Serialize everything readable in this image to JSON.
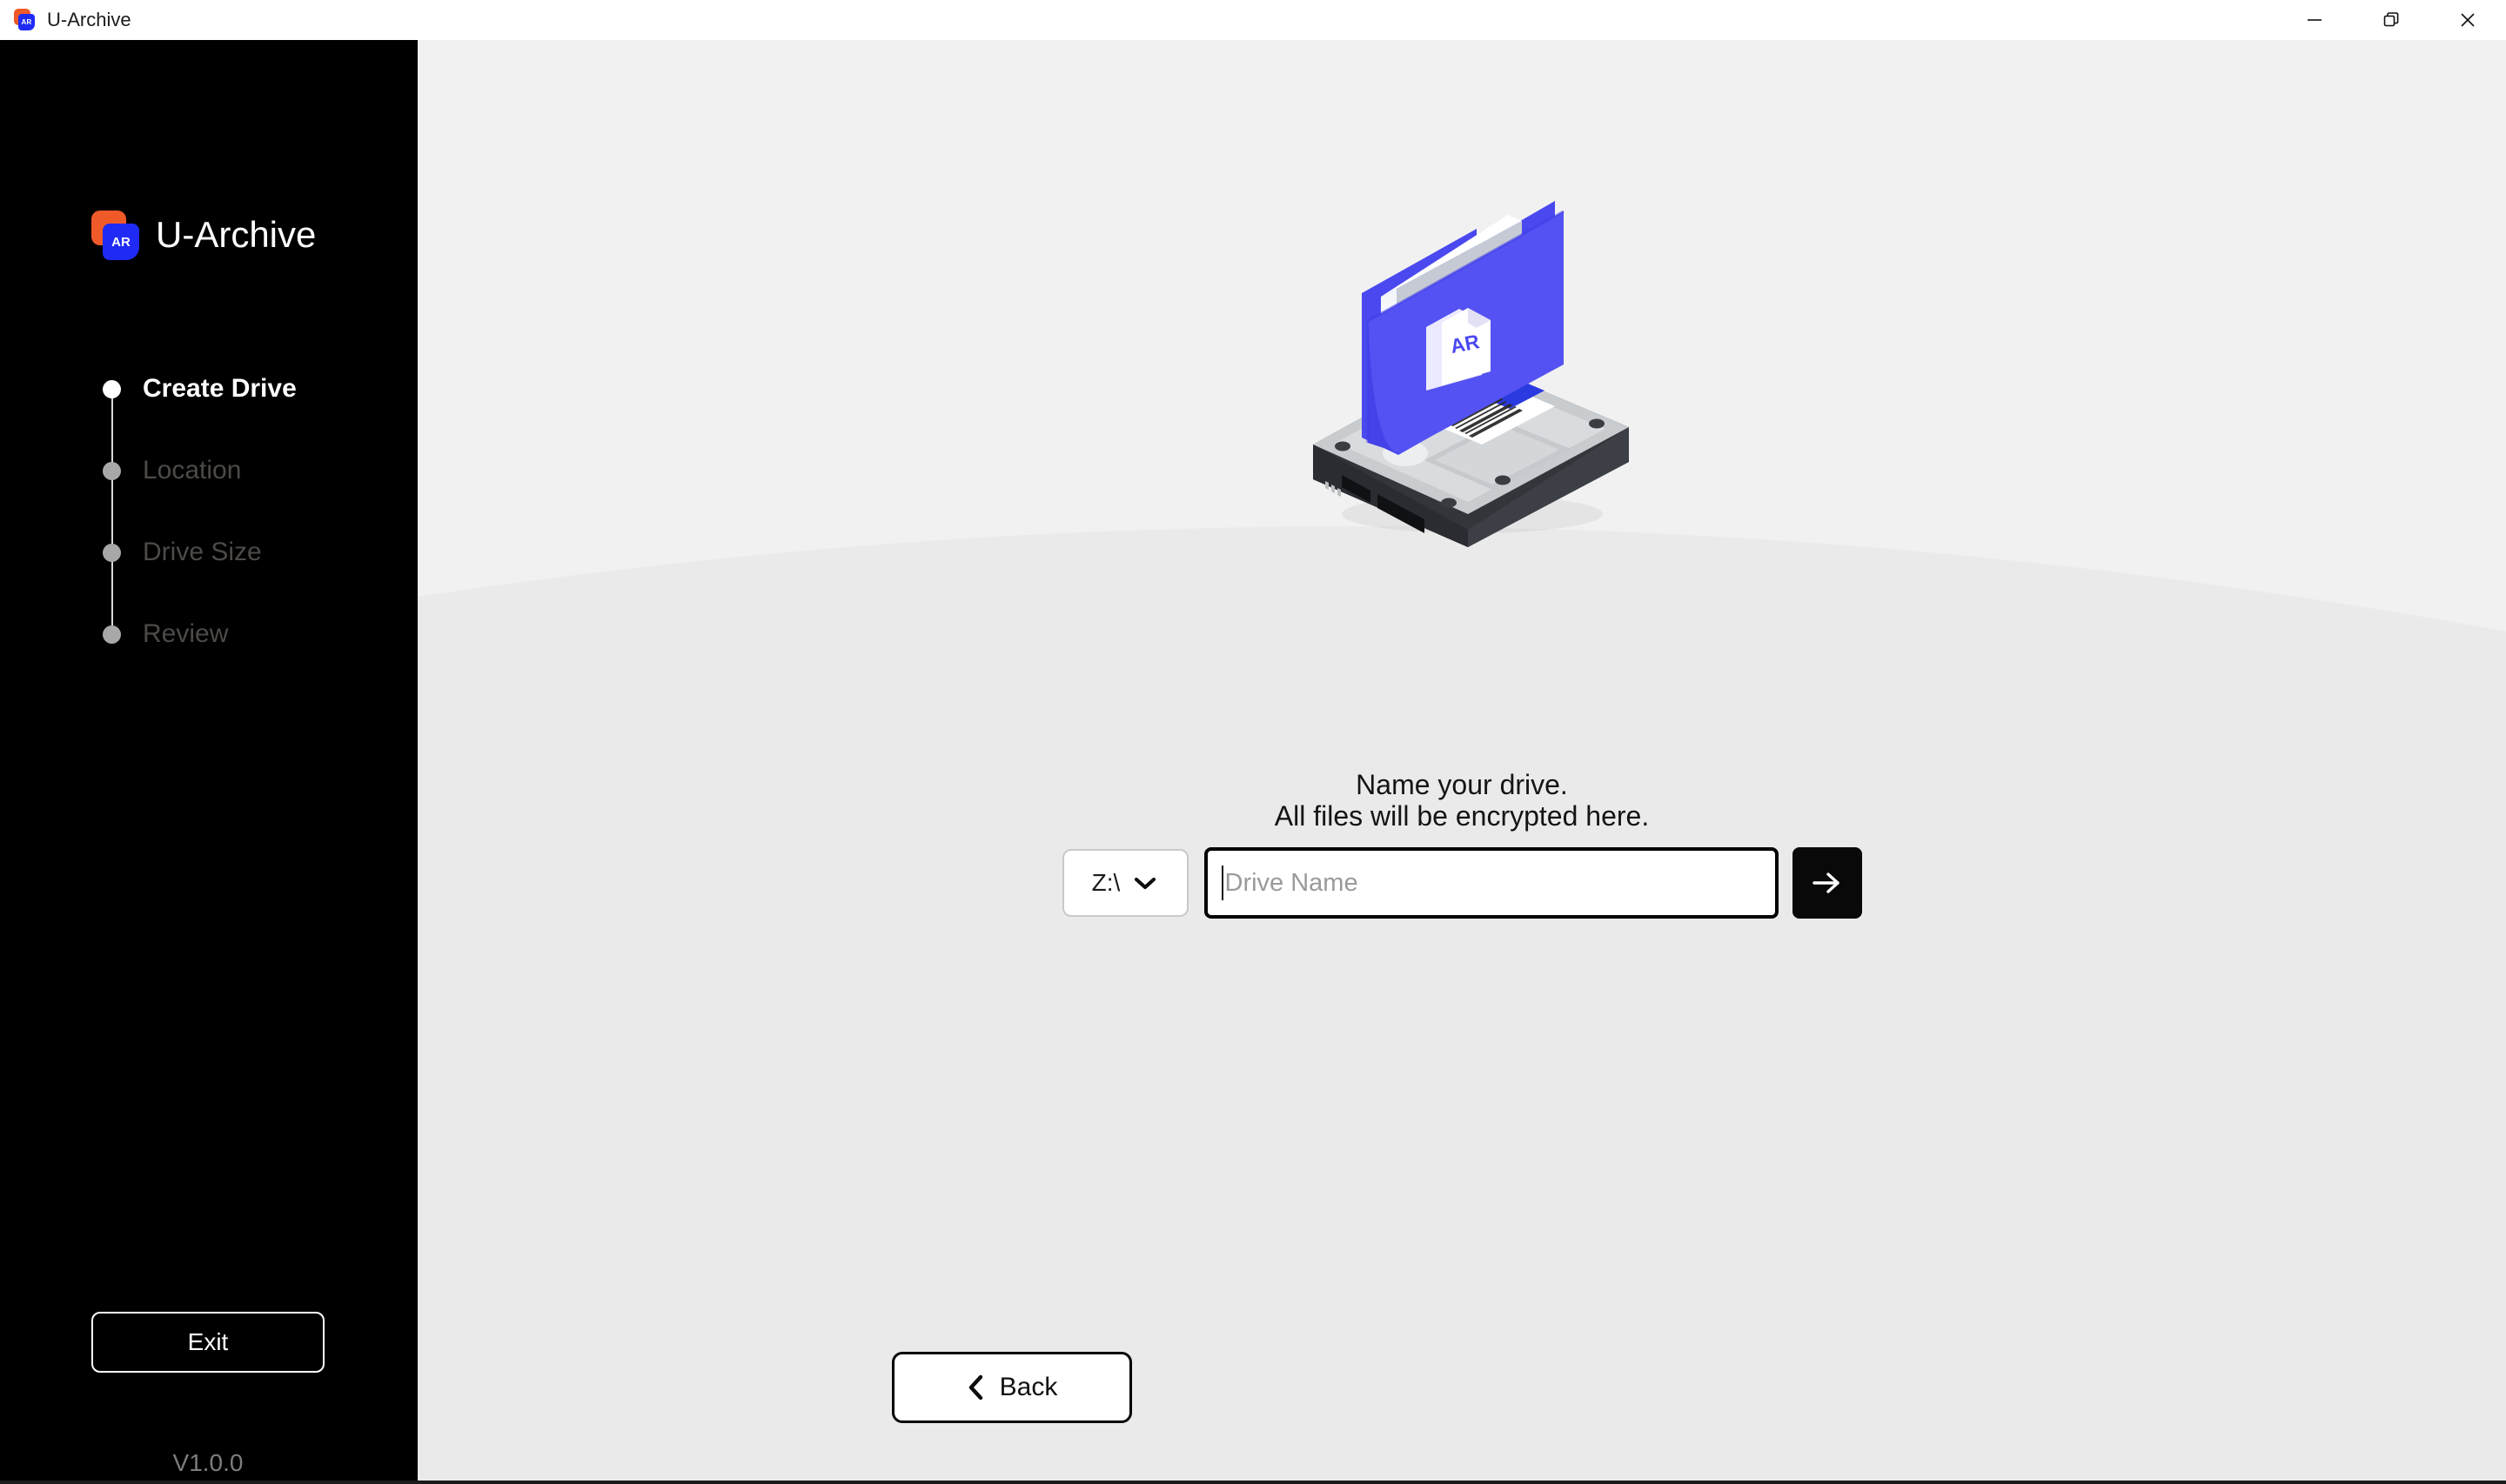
{
  "window": {
    "title": "U-Archive",
    "logo_text": "AR",
    "controls": {
      "minimize": "minimize-icon",
      "restore": "restore-icon",
      "close": "close-icon"
    }
  },
  "sidebar": {
    "brand": "U-Archive",
    "brand_mark_text": "AR",
    "steps": [
      {
        "label": "Create Drive",
        "state": "active"
      },
      {
        "label": "Location",
        "state": "pending"
      },
      {
        "label": "Drive Size",
        "state": "pending"
      },
      {
        "label": "Review",
        "state": "pending"
      }
    ],
    "exit_label": "Exit",
    "version": "V1.0.0"
  },
  "main": {
    "illustration": {
      "name": "hard-drive-folder-illustration",
      "document_label": "AR"
    },
    "prompt_line_1": "Name your drive.",
    "prompt_line_2": "All files will be encrypted here.",
    "drive_letter": "Z:\\",
    "drive_name_value": "",
    "drive_name_placeholder": "Drive Name",
    "next_icon": "arrow-right-icon",
    "back_label": "Back"
  },
  "colors": {
    "sidebar_bg": "#000000",
    "main_bg": "#f1f1f1",
    "main_bg_lower": "#eaeaea",
    "brand_orange": "#ef5a28",
    "brand_blue": "#1f2bf5",
    "accent_black": "#000000",
    "muted_text": "#4d4a47"
  }
}
